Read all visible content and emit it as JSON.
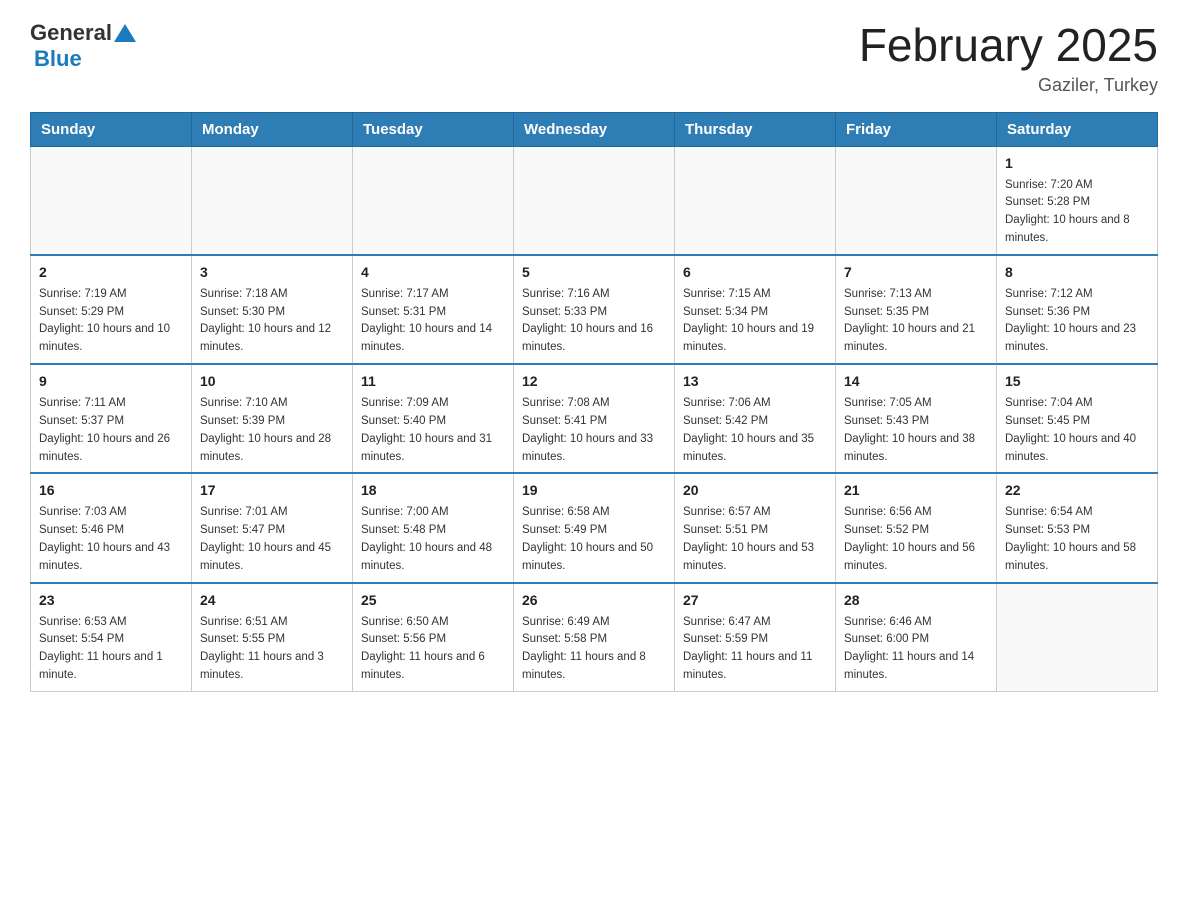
{
  "header": {
    "logo_general": "General",
    "logo_blue": "Blue",
    "title": "February 2025",
    "subtitle": "Gaziler, Turkey"
  },
  "weekdays": [
    "Sunday",
    "Monday",
    "Tuesday",
    "Wednesday",
    "Thursday",
    "Friday",
    "Saturday"
  ],
  "weeks": [
    [
      {
        "day": "",
        "sunrise": "",
        "sunset": "",
        "daylight": ""
      },
      {
        "day": "",
        "sunrise": "",
        "sunset": "",
        "daylight": ""
      },
      {
        "day": "",
        "sunrise": "",
        "sunset": "",
        "daylight": ""
      },
      {
        "day": "",
        "sunrise": "",
        "sunset": "",
        "daylight": ""
      },
      {
        "day": "",
        "sunrise": "",
        "sunset": "",
        "daylight": ""
      },
      {
        "day": "",
        "sunrise": "",
        "sunset": "",
        "daylight": ""
      },
      {
        "day": "1",
        "sunrise": "Sunrise: 7:20 AM",
        "sunset": "Sunset: 5:28 PM",
        "daylight": "Daylight: 10 hours and 8 minutes."
      }
    ],
    [
      {
        "day": "2",
        "sunrise": "Sunrise: 7:19 AM",
        "sunset": "Sunset: 5:29 PM",
        "daylight": "Daylight: 10 hours and 10 minutes."
      },
      {
        "day": "3",
        "sunrise": "Sunrise: 7:18 AM",
        "sunset": "Sunset: 5:30 PM",
        "daylight": "Daylight: 10 hours and 12 minutes."
      },
      {
        "day": "4",
        "sunrise": "Sunrise: 7:17 AM",
        "sunset": "Sunset: 5:31 PM",
        "daylight": "Daylight: 10 hours and 14 minutes."
      },
      {
        "day": "5",
        "sunrise": "Sunrise: 7:16 AM",
        "sunset": "Sunset: 5:33 PM",
        "daylight": "Daylight: 10 hours and 16 minutes."
      },
      {
        "day": "6",
        "sunrise": "Sunrise: 7:15 AM",
        "sunset": "Sunset: 5:34 PM",
        "daylight": "Daylight: 10 hours and 19 minutes."
      },
      {
        "day": "7",
        "sunrise": "Sunrise: 7:13 AM",
        "sunset": "Sunset: 5:35 PM",
        "daylight": "Daylight: 10 hours and 21 minutes."
      },
      {
        "day": "8",
        "sunrise": "Sunrise: 7:12 AM",
        "sunset": "Sunset: 5:36 PM",
        "daylight": "Daylight: 10 hours and 23 minutes."
      }
    ],
    [
      {
        "day": "9",
        "sunrise": "Sunrise: 7:11 AM",
        "sunset": "Sunset: 5:37 PM",
        "daylight": "Daylight: 10 hours and 26 minutes."
      },
      {
        "day": "10",
        "sunrise": "Sunrise: 7:10 AM",
        "sunset": "Sunset: 5:39 PM",
        "daylight": "Daylight: 10 hours and 28 minutes."
      },
      {
        "day": "11",
        "sunrise": "Sunrise: 7:09 AM",
        "sunset": "Sunset: 5:40 PM",
        "daylight": "Daylight: 10 hours and 31 minutes."
      },
      {
        "day": "12",
        "sunrise": "Sunrise: 7:08 AM",
        "sunset": "Sunset: 5:41 PM",
        "daylight": "Daylight: 10 hours and 33 minutes."
      },
      {
        "day": "13",
        "sunrise": "Sunrise: 7:06 AM",
        "sunset": "Sunset: 5:42 PM",
        "daylight": "Daylight: 10 hours and 35 minutes."
      },
      {
        "day": "14",
        "sunrise": "Sunrise: 7:05 AM",
        "sunset": "Sunset: 5:43 PM",
        "daylight": "Daylight: 10 hours and 38 minutes."
      },
      {
        "day": "15",
        "sunrise": "Sunrise: 7:04 AM",
        "sunset": "Sunset: 5:45 PM",
        "daylight": "Daylight: 10 hours and 40 minutes."
      }
    ],
    [
      {
        "day": "16",
        "sunrise": "Sunrise: 7:03 AM",
        "sunset": "Sunset: 5:46 PM",
        "daylight": "Daylight: 10 hours and 43 minutes."
      },
      {
        "day": "17",
        "sunrise": "Sunrise: 7:01 AM",
        "sunset": "Sunset: 5:47 PM",
        "daylight": "Daylight: 10 hours and 45 minutes."
      },
      {
        "day": "18",
        "sunrise": "Sunrise: 7:00 AM",
        "sunset": "Sunset: 5:48 PM",
        "daylight": "Daylight: 10 hours and 48 minutes."
      },
      {
        "day": "19",
        "sunrise": "Sunrise: 6:58 AM",
        "sunset": "Sunset: 5:49 PM",
        "daylight": "Daylight: 10 hours and 50 minutes."
      },
      {
        "day": "20",
        "sunrise": "Sunrise: 6:57 AM",
        "sunset": "Sunset: 5:51 PM",
        "daylight": "Daylight: 10 hours and 53 minutes."
      },
      {
        "day": "21",
        "sunrise": "Sunrise: 6:56 AM",
        "sunset": "Sunset: 5:52 PM",
        "daylight": "Daylight: 10 hours and 56 minutes."
      },
      {
        "day": "22",
        "sunrise": "Sunrise: 6:54 AM",
        "sunset": "Sunset: 5:53 PM",
        "daylight": "Daylight: 10 hours and 58 minutes."
      }
    ],
    [
      {
        "day": "23",
        "sunrise": "Sunrise: 6:53 AM",
        "sunset": "Sunset: 5:54 PM",
        "daylight": "Daylight: 11 hours and 1 minute."
      },
      {
        "day": "24",
        "sunrise": "Sunrise: 6:51 AM",
        "sunset": "Sunset: 5:55 PM",
        "daylight": "Daylight: 11 hours and 3 minutes."
      },
      {
        "day": "25",
        "sunrise": "Sunrise: 6:50 AM",
        "sunset": "Sunset: 5:56 PM",
        "daylight": "Daylight: 11 hours and 6 minutes."
      },
      {
        "day": "26",
        "sunrise": "Sunrise: 6:49 AM",
        "sunset": "Sunset: 5:58 PM",
        "daylight": "Daylight: 11 hours and 8 minutes."
      },
      {
        "day": "27",
        "sunrise": "Sunrise: 6:47 AM",
        "sunset": "Sunset: 5:59 PM",
        "daylight": "Daylight: 11 hours and 11 minutes."
      },
      {
        "day": "28",
        "sunrise": "Sunrise: 6:46 AM",
        "sunset": "Sunset: 6:00 PM",
        "daylight": "Daylight: 11 hours and 14 minutes."
      },
      {
        "day": "",
        "sunrise": "",
        "sunset": "",
        "daylight": ""
      }
    ]
  ]
}
